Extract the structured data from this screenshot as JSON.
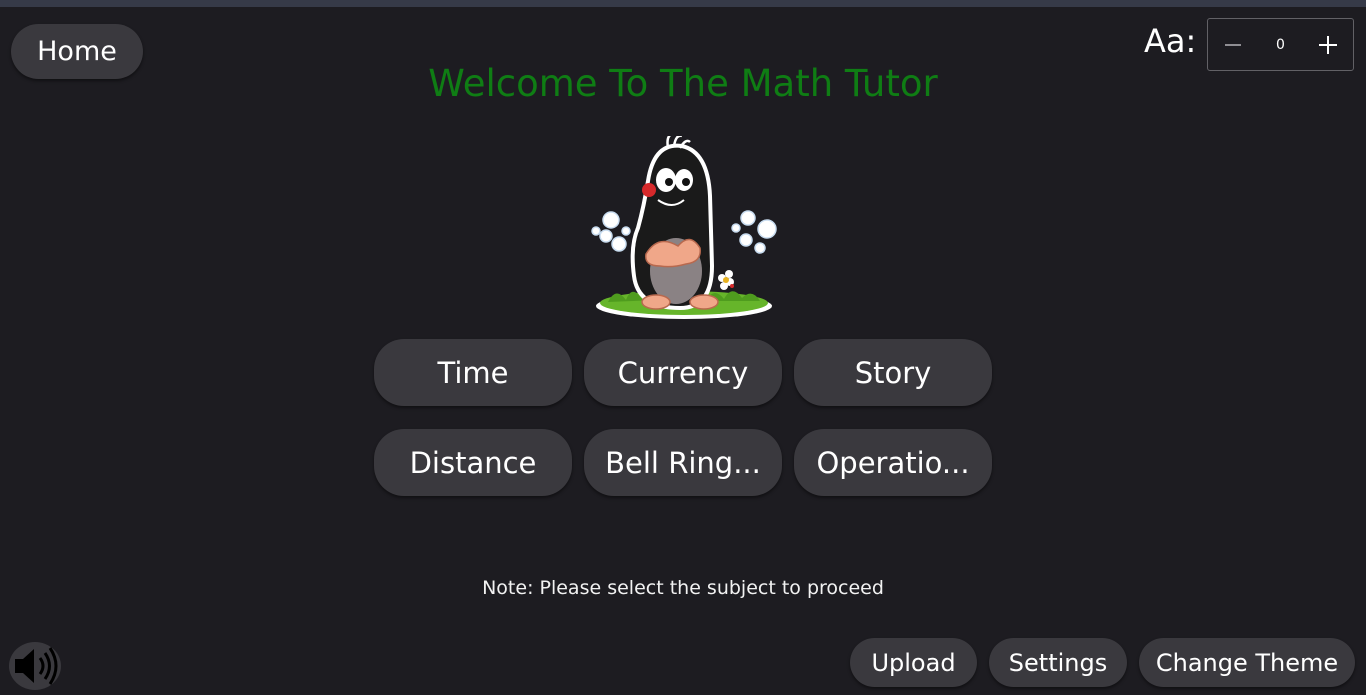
{
  "header": {
    "home_label": "Home",
    "title": "Welcome To The Math Tutor",
    "font_size_label": "Aa:",
    "font_size_value": "0",
    "title_color": "#0f7d14"
  },
  "mascot": {
    "icon": "mole-icon"
  },
  "subjects": [
    {
      "label": "Time"
    },
    {
      "label": "Currency"
    },
    {
      "label": "Story"
    },
    {
      "label": "Distance"
    },
    {
      "label": "Bell Ring..."
    },
    {
      "label": "Operatio..."
    }
  ],
  "note": "Note: Please select the subject to proceed",
  "footer": {
    "speaker_icon": "speaker-icon",
    "upload_label": "Upload",
    "settings_label": "Settings",
    "change_theme_label": "Change Theme"
  }
}
